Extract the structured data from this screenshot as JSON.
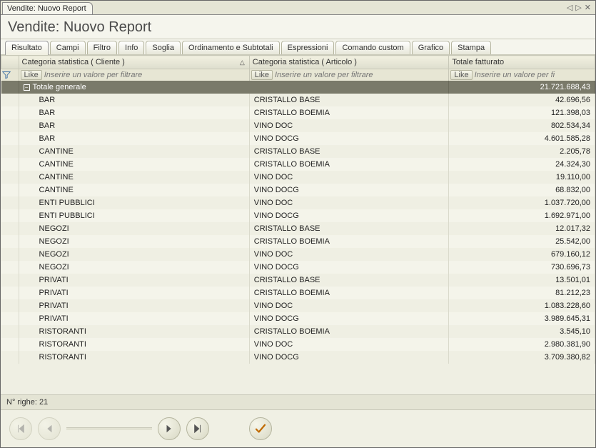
{
  "window": {
    "tab_title": "Vendite: Nuovo Report"
  },
  "header": {
    "title": "Vendite: Nuovo Report"
  },
  "subtabs": {
    "active": 0,
    "items": [
      {
        "label": "Risultato"
      },
      {
        "label": "Campi"
      },
      {
        "label": "Filtro"
      },
      {
        "label": "Info"
      },
      {
        "label": "Soglia"
      },
      {
        "label": "Ordinamento e Subtotali"
      },
      {
        "label": "Espressioni"
      },
      {
        "label": "Comando custom"
      },
      {
        "label": "Grafico"
      },
      {
        "label": "Stampa"
      }
    ]
  },
  "grid": {
    "columns": [
      {
        "label": "Categoria statistica ( Cliente )",
        "filter_op": "Like",
        "filter_placeholder": "Inserire un valore per filtrare",
        "sort": "asc"
      },
      {
        "label": "Categoria statistica ( Articolo )",
        "filter_op": "Like",
        "filter_placeholder": "Inserire un valore per filtrare"
      },
      {
        "label": "Totale fatturato",
        "filter_op": "Like",
        "filter_placeholder": "Inserire un valore per fi"
      }
    ],
    "grand_total": {
      "label": "Totale generale",
      "value": "21.721.688,43"
    },
    "rows": [
      {
        "cliente": "BAR",
        "articolo": "CRISTALLO BASE",
        "fatt": "42.696,56"
      },
      {
        "cliente": "BAR",
        "articolo": "CRISTALLO BOEMIA",
        "fatt": "121.398,03"
      },
      {
        "cliente": "BAR",
        "articolo": "VINO DOC",
        "fatt": "802.534,34"
      },
      {
        "cliente": "BAR",
        "articolo": "VINO DOCG",
        "fatt": "4.601.585,28"
      },
      {
        "cliente": "CANTINE",
        "articolo": "CRISTALLO BASE",
        "fatt": "2.205,78"
      },
      {
        "cliente": "CANTINE",
        "articolo": "CRISTALLO BOEMIA",
        "fatt": "24.324,30"
      },
      {
        "cliente": "CANTINE",
        "articolo": "VINO DOC",
        "fatt": "19.110,00"
      },
      {
        "cliente": "CANTINE",
        "articolo": "VINO DOCG",
        "fatt": "68.832,00"
      },
      {
        "cliente": "ENTI PUBBLICI",
        "articolo": "VINO DOC",
        "fatt": "1.037.720,00"
      },
      {
        "cliente": "ENTI PUBBLICI",
        "articolo": "VINO DOCG",
        "fatt": "1.692.971,00"
      },
      {
        "cliente": "NEGOZI",
        "articolo": "CRISTALLO BASE",
        "fatt": "12.017,32"
      },
      {
        "cliente": "NEGOZI",
        "articolo": "CRISTALLO BOEMIA",
        "fatt": "25.542,00"
      },
      {
        "cliente": "NEGOZI",
        "articolo": "VINO DOC",
        "fatt": "679.160,12"
      },
      {
        "cliente": "NEGOZI",
        "articolo": "VINO DOCG",
        "fatt": "730.696,73"
      },
      {
        "cliente": "PRIVATI",
        "articolo": "CRISTALLO BASE",
        "fatt": "13.501,01"
      },
      {
        "cliente": "PRIVATI",
        "articolo": "CRISTALLO BOEMIA",
        "fatt": "81.212,23"
      },
      {
        "cliente": "PRIVATI",
        "articolo": "VINO DOC",
        "fatt": "1.083.228,60"
      },
      {
        "cliente": "PRIVATI",
        "articolo": "VINO DOCG",
        "fatt": "3.989.645,31"
      },
      {
        "cliente": "RISTORANTI",
        "articolo": "CRISTALLO BOEMIA",
        "fatt": "3.545,10"
      },
      {
        "cliente": "RISTORANTI",
        "articolo": "VINO DOC",
        "fatt": "2.980.381,90"
      },
      {
        "cliente": "RISTORANTI",
        "articolo": "VINO DOCG",
        "fatt": "3.709.380,82"
      }
    ]
  },
  "status": {
    "row_count_label": "N° righe: 21"
  }
}
